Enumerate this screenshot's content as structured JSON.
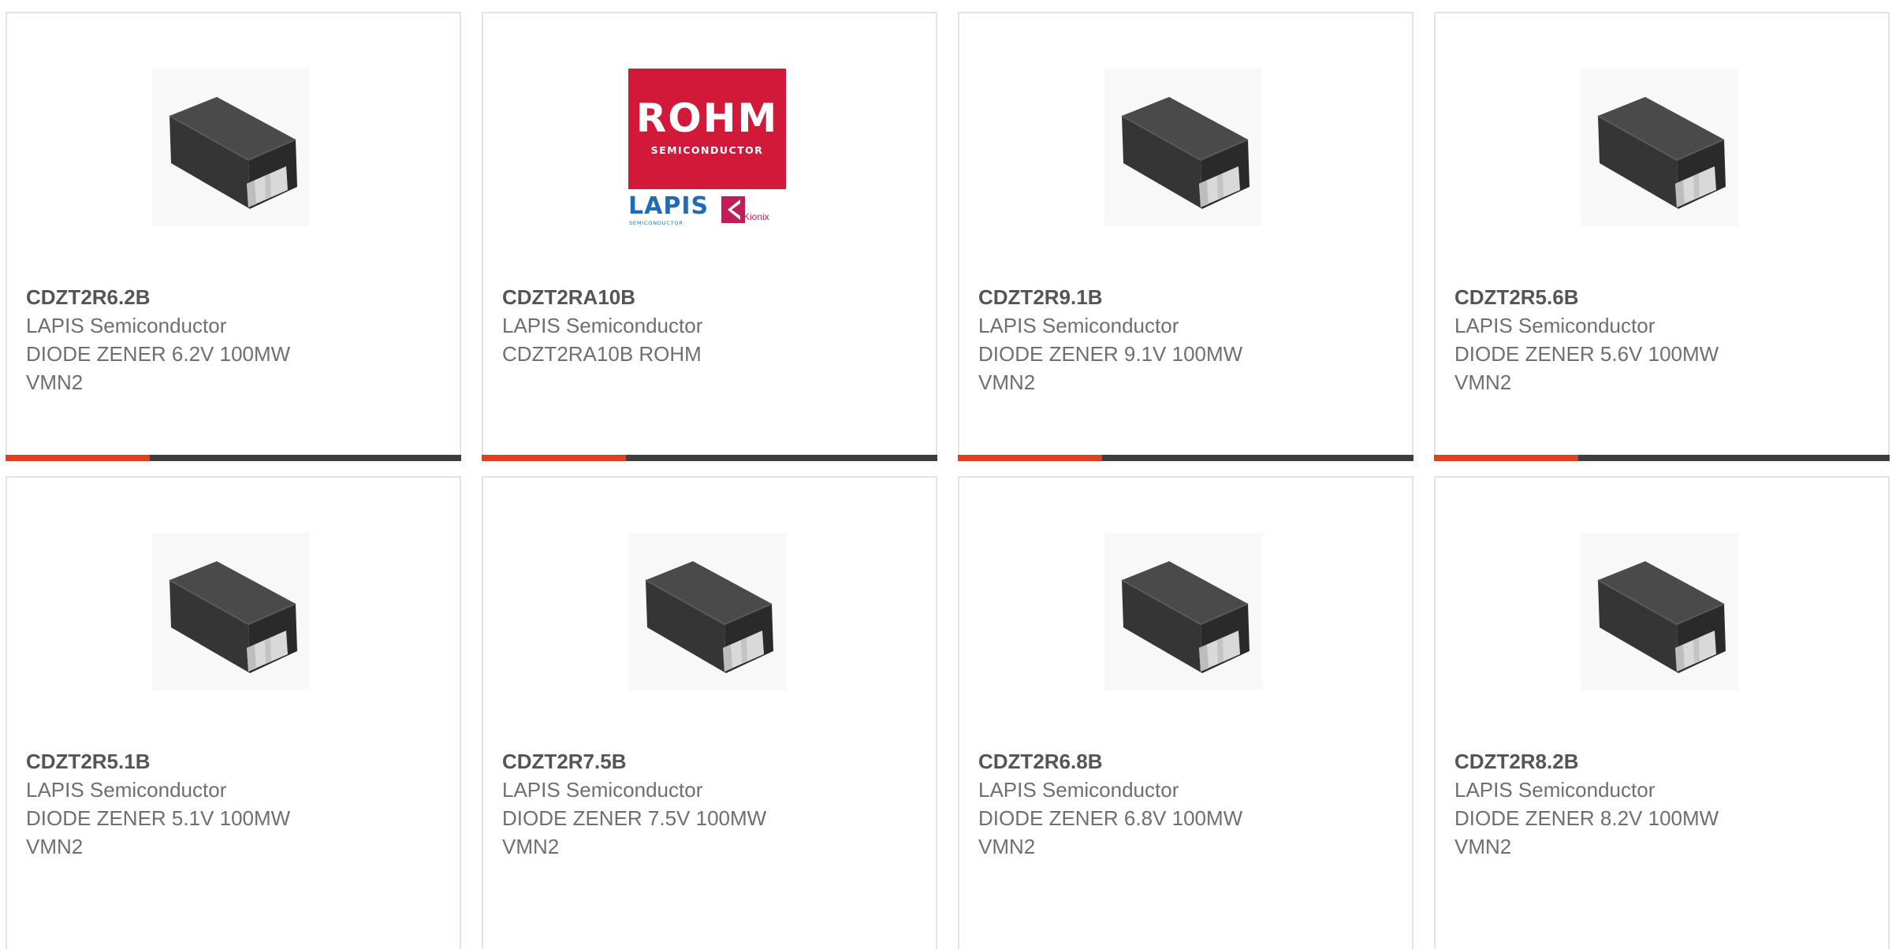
{
  "products": [
    {
      "part": "CDZT2R6.2B",
      "manufacturer": "LAPIS Semiconductor",
      "desc1": "DIODE ZENER 6.2V 100MW",
      "desc2": "VMN2",
      "image": "diode-package-icon"
    },
    {
      "part": "CDZT2RA10B",
      "manufacturer": "LAPIS Semiconductor",
      "desc1": "CDZT2RA10B ROHM",
      "desc2": "",
      "image": "manufacturer-logo",
      "logo": {
        "brand": "ROHM",
        "brand_sub": "SEMICONDUCTOR",
        "partner1": "LAPIS",
        "partner1_sub": "SEMICONDUCTOR",
        "partner2": "Kionix",
        "brand_color": "#d2193a",
        "partner1_color": "#1f6bb5",
        "partner2_color": "#c21d56"
      }
    },
    {
      "part": "CDZT2R9.1B",
      "manufacturer": "LAPIS Semiconductor",
      "desc1": "DIODE ZENER 9.1V 100MW",
      "desc2": "VMN2",
      "image": "diode-package-icon"
    },
    {
      "part": "CDZT2R5.6B",
      "manufacturer": "LAPIS Semiconductor",
      "desc1": "DIODE ZENER 5.6V 100MW",
      "desc2": "VMN2",
      "image": "diode-package-icon"
    },
    {
      "part": "CDZT2R5.1B",
      "manufacturer": "LAPIS Semiconductor",
      "desc1": "DIODE ZENER 5.1V 100MW",
      "desc2": "VMN2",
      "image": "diode-package-icon"
    },
    {
      "part": "CDZT2R7.5B",
      "manufacturer": "LAPIS Semiconductor",
      "desc1": "DIODE ZENER 7.5V 100MW",
      "desc2": "VMN2",
      "image": "diode-package-icon"
    },
    {
      "part": "CDZT2R6.8B",
      "manufacturer": "LAPIS Semiconductor",
      "desc1": "DIODE ZENER 6.8V 100MW",
      "desc2": "VMN2",
      "image": "diode-package-icon"
    },
    {
      "part": "CDZT2R8.2B",
      "manufacturer": "LAPIS Semiconductor",
      "desc1": "DIODE ZENER 8.2V 100MW",
      "desc2": "VMN2",
      "image": "diode-package-icon"
    }
  ],
  "colors": {
    "accent": "#e2401b",
    "bar": "#3d3d3d",
    "card_border": "#e3e3e3",
    "text": "#6f6f6f"
  }
}
